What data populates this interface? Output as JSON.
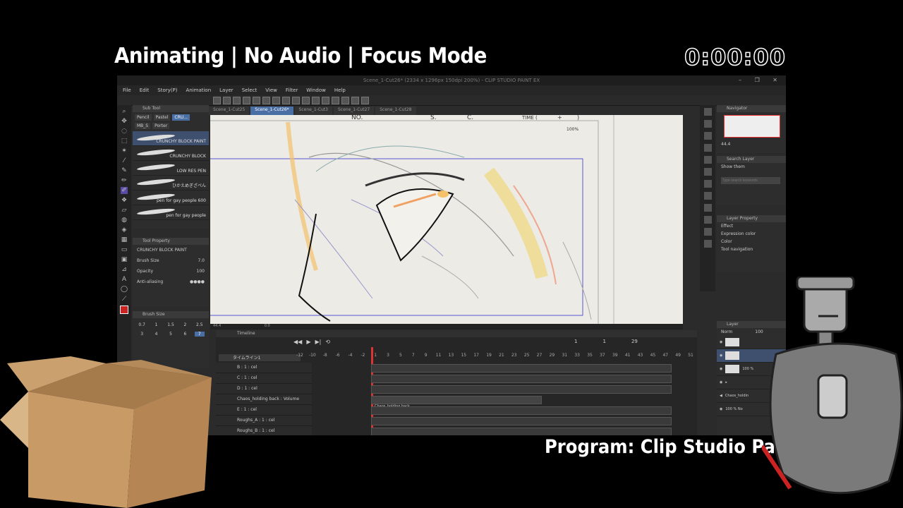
{
  "overlay": {
    "title": "Animating | No Audio | Focus Mode",
    "timer": "0:00:00",
    "program": "Program: Clip Studio Paint EX"
  },
  "app": {
    "window_title": "Scene_1-Cut26* (2334 x 1296px 150dpi 200%) - CLIP STUDIO PAINT EX",
    "menu": [
      "File",
      "Edit",
      "Story(P)",
      "Animation",
      "Layer",
      "Select",
      "View",
      "Filter",
      "Window",
      "Help"
    ],
    "tabs": [
      "Scene_1-Cut25",
      "Scene_1-Cut26*",
      "Scene_1-Cut3",
      "Scene_1-Cut27",
      "Scene_1-Cut28"
    ],
    "subtool": {
      "header": "Sub Tool",
      "tabs": [
        "Pencil",
        "Pastel",
        "CRU...",
        "MB_S",
        "Porter"
      ],
      "brushes": [
        "CRUNCHY BLOCK PAINT",
        "CRUNCHY BLOCK",
        "LOW RES PEN",
        "ひかえめぎざぺん",
        "pen for gay people 600",
        "pen for gay people"
      ]
    },
    "tool_property": {
      "header": "Tool Property",
      "tool_name": "CRUNCHY BLOCK PAINT",
      "brush_size_label": "Brush Size",
      "brush_size_value": "7.0",
      "opacity_label": "Opacity",
      "opacity_value": "100",
      "antialias_label": "Anti-aliasing"
    },
    "brush_size_panel": {
      "header": "Brush Size",
      "sizes": [
        "0.7",
        "1",
        "1.5",
        "2",
        "2.5",
        "3",
        "4",
        "5",
        "6",
        "7"
      ]
    },
    "canvas": {
      "frame_labels": [
        "NO.",
        "S.",
        "C.",
        "TIME (",
        "+",
        ")"
      ],
      "zoom_mark": "100%",
      "status_zoom": "44.4",
      "status_angle": "0.0"
    },
    "navigator": {
      "header": "Navigator",
      "zoom": "44.4"
    },
    "search_layer": {
      "header": "Search Layer",
      "show": "Show them",
      "placeholder": "Type search keywords"
    },
    "layer_property": {
      "header": "Layer Property",
      "effect_label": "Effect",
      "expression_label": "Expression color",
      "expression_value": "Color",
      "tool_nav_label": "Tool navigation"
    },
    "layer_panel": {
      "header": "Layer",
      "blend": "Norm",
      "opacity": "100",
      "rows": [
        "",
        "",
        "100 %",
        "",
        "Chaos_holdin",
        "100 % No"
      ]
    },
    "timeline": {
      "header": "Timeline",
      "track_selector": "タイムライン1",
      "counter_left": "1",
      "counter_mid": "1",
      "counter_right": "29",
      "ruler": [
        "-12",
        "-10",
        "-8",
        "-6",
        "-4",
        "-2",
        "1",
        "3",
        "5",
        "7",
        "9",
        "11",
        "13",
        "15",
        "17",
        "19",
        "21",
        "23",
        "25",
        "27",
        "29",
        "31",
        "33",
        "35",
        "37",
        "39",
        "41",
        "43",
        "45",
        "47",
        "49",
        "51"
      ],
      "tracks": [
        "B : 1 : cel",
        "C : 1 : cel",
        "D : 1 : cel",
        "Chaos_holding back : Volume",
        "E : 1 : cel",
        "Roughs_A : 1 : cel",
        "Roughs_B : 1 : cel"
      ],
      "audio_clip": "Chaos_holding back"
    }
  }
}
